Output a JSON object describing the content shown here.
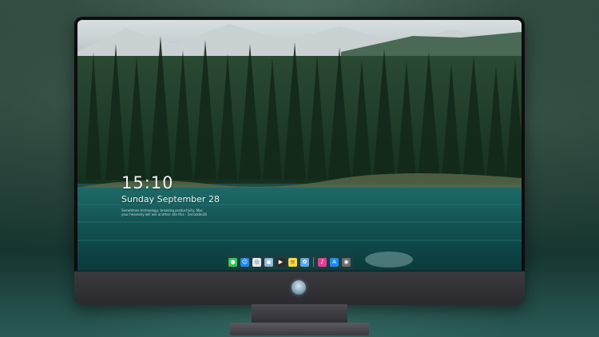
{
  "lockscreen": {
    "time": "15:10",
    "date": "Sunday September 28",
    "caption_line1": "Sometimes technology, breaking productivity, Mac",
    "caption_line2": "your heavenly will ask another site this - 5eccok0e28"
  },
  "dock": {
    "apps": [
      {
        "name": "messages-icon",
        "color": "#34c759"
      },
      {
        "name": "finder-icon",
        "color": "#1e88e5"
      },
      {
        "name": "safari-icon",
        "color": "#e8e8e8"
      },
      {
        "name": "preview-icon",
        "color": "#8fb6d6"
      },
      {
        "name": "final-cut-icon",
        "color": "#2b2b2b"
      },
      {
        "name": "notes-icon",
        "color": "#f5d54a"
      },
      {
        "name": "photos-icon",
        "color": "#5fa8e8"
      },
      {
        "name": "itunes-icon",
        "color": "#e0408f"
      },
      {
        "name": "app-store-icon",
        "color": "#1b8cf0"
      },
      {
        "name": "camera-icon",
        "color": "#6c6c70"
      }
    ]
  },
  "colors": {
    "bezel": "#0c0c0e",
    "chin": "#2b2b2f",
    "lake": "#0f4a4d",
    "forest": "#1f3a2a"
  }
}
